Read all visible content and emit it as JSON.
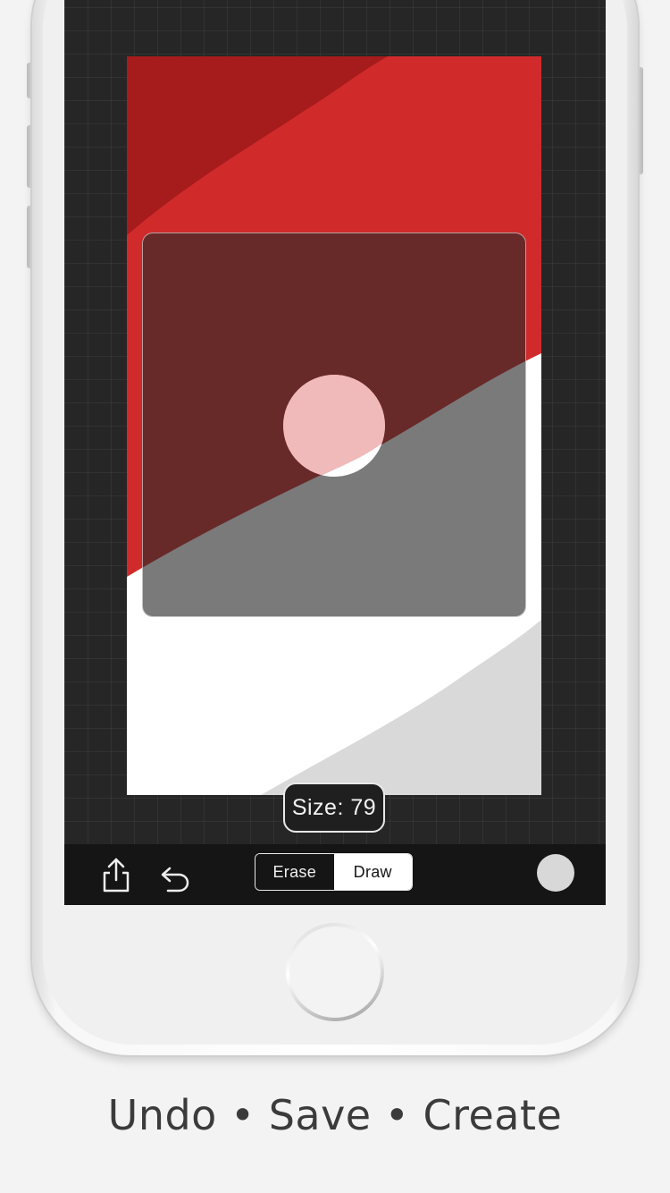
{
  "colors": {
    "red_dark": "#a61b1b",
    "red": "#d02a2b",
    "white": "#ffffff",
    "light_gray": "#d9d9d9",
    "brush_color": "#d8d8d8",
    "cursor_pink": "#f0b9ba"
  },
  "canvas": {
    "size_label": "Size: 79"
  },
  "toolbar": {
    "share_icon": "share-icon",
    "undo_icon": "undo-icon",
    "mode_options": [
      "Erase",
      "Draw"
    ],
    "selected_mode": "Draw",
    "erase_label": "Erase",
    "draw_label": "Draw"
  },
  "caption": {
    "text": "Undo • Save • Create"
  }
}
